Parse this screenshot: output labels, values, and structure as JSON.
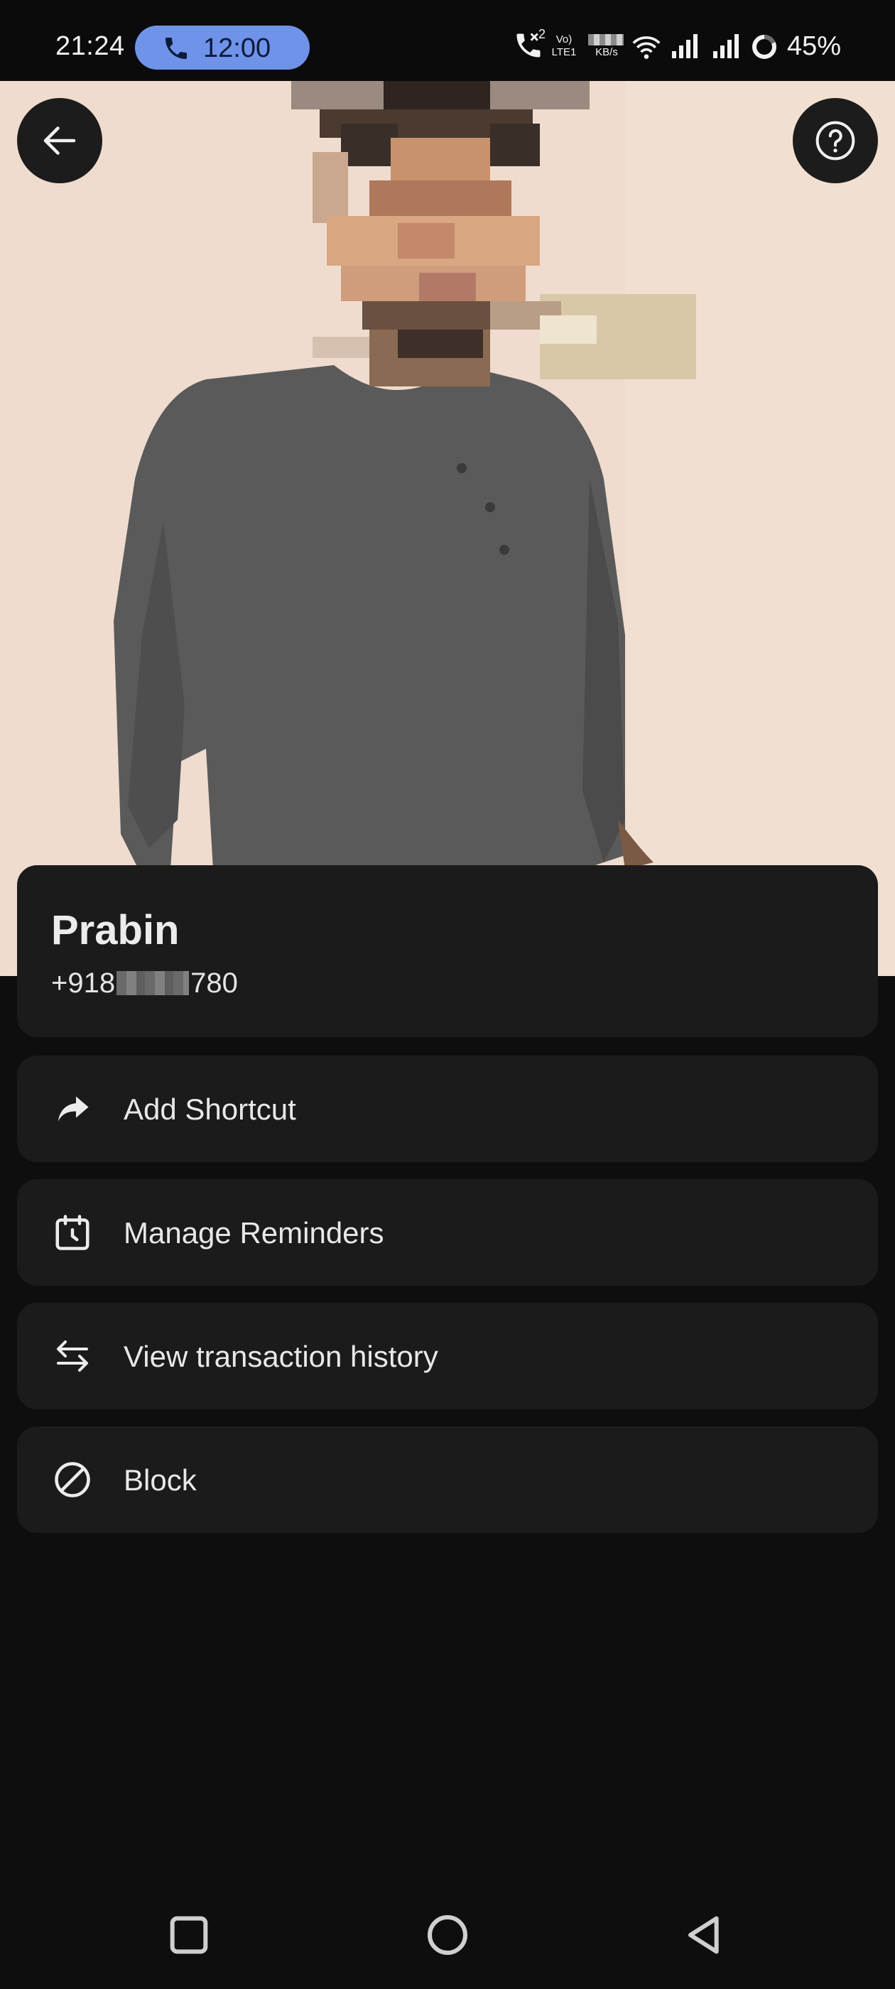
{
  "status_bar": {
    "time": "21:24",
    "call_timer": "12:00",
    "battery": "45%",
    "network_label_1": "Vo)",
    "network_label_2": "LTE1",
    "speed_unit": "KB/s",
    "call_sim": "2"
  },
  "header": {
    "back_icon": "arrow-left-icon",
    "help_icon": "question-circle-icon"
  },
  "contact": {
    "name": "Prabin",
    "phone_prefix": "+918",
    "phone_suffix": "780"
  },
  "actions": [
    {
      "label": "Add Shortcut",
      "icon": "share-arrow-icon"
    },
    {
      "label": "Manage Reminders",
      "icon": "calendar-clock-icon"
    },
    {
      "label": "View transaction history",
      "icon": "transfer-arrows-icon"
    },
    {
      "label": "Block",
      "icon": "block-icon"
    }
  ],
  "colors": {
    "background": "#0e0e0e",
    "card": "#1b1b1b",
    "call_pill": "#6f93e8",
    "text": "#ececec"
  }
}
